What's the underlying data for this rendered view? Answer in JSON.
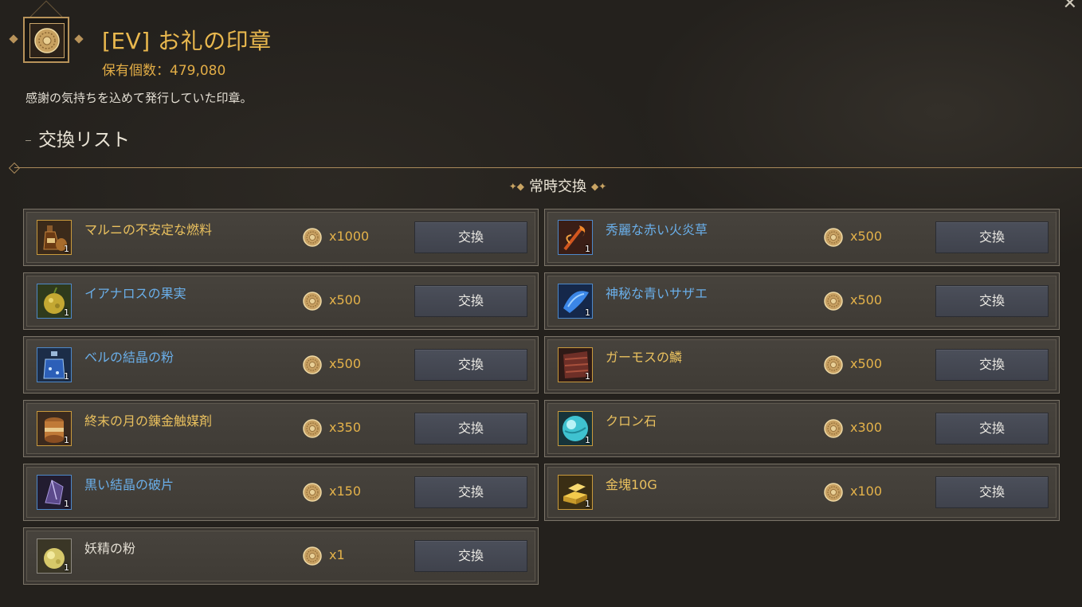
{
  "header": {
    "title": "[EV] お礼の印章",
    "owned_label": "保有個数：479,080",
    "description": "感謝の気持ちを込めて発行していた印章。",
    "section_title": "交換リスト",
    "subsection_title": "常時交換"
  },
  "exchange_button_label": "交換",
  "items": [
    {
      "name": "マルニの不安定な燃料",
      "price": "x1000",
      "qty": "1",
      "grade": "yellow",
      "icon": "fuel-bottle-icon"
    },
    {
      "name": "秀麗な赤い火炎草",
      "price": "x500",
      "qty": "1",
      "grade": "blue",
      "icon": "red-flame-grass-icon"
    },
    {
      "name": "イアナロスの果実",
      "price": "x500",
      "qty": "1",
      "grade": "blue",
      "icon": "ianaros-fruit-icon"
    },
    {
      "name": "神秘な青いサザエ",
      "price": "x500",
      "qty": "1",
      "grade": "blue",
      "icon": "blue-shell-icon"
    },
    {
      "name": "ベルの結晶の粉",
      "price": "x500",
      "qty": "1",
      "grade": "blue",
      "icon": "crystal-powder-icon"
    },
    {
      "name": "ガーモスの鱗",
      "price": "x500",
      "qty": "1",
      "grade": "yellow",
      "icon": "garmoth-scale-icon"
    },
    {
      "name": "終末の月の錬金触媒剤",
      "price": "x350",
      "qty": "1",
      "grade": "yellow",
      "icon": "alchemy-catalyst-icon"
    },
    {
      "name": "クロン石",
      "price": "x300",
      "qty": "1",
      "grade": "yellow",
      "icon": "cron-stone-icon"
    },
    {
      "name": "黒い結晶の破片",
      "price": "x150",
      "qty": "1",
      "grade": "blue",
      "icon": "black-crystal-shard-icon"
    },
    {
      "name": "金塊10G",
      "price": "x100",
      "qty": "1",
      "grade": "yellow",
      "icon": "gold-bar-icon"
    },
    {
      "name": "妖精の粉",
      "price": "x1",
      "qty": "1",
      "grade": "white",
      "icon": "fairy-powder-icon"
    }
  ],
  "colors": {
    "title_gold": "#e9b84e",
    "grade_yellow": "#e9c05e",
    "grade_blue": "#6aaee8",
    "grade_white": "#e2ddd2"
  },
  "icons": {
    "close": "close-icon",
    "seal": "seal-icon",
    "coin": "seal-coin-icon"
  }
}
